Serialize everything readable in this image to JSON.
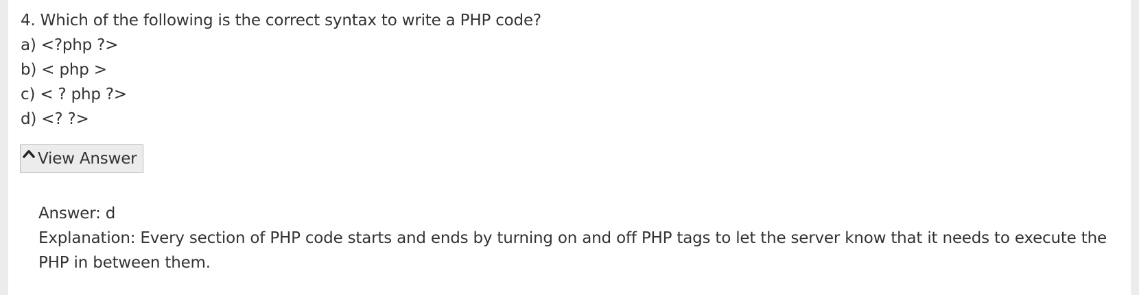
{
  "question": {
    "text": "4. Which of the following is the correct syntax to write a PHP code?",
    "options": [
      "a) <?php ?>",
      "b) < php >",
      "c) < ? php ?>",
      "d) <? ?>"
    ]
  },
  "view_answer": {
    "label": "View Answer",
    "icon": "caret-up-icon"
  },
  "answer": {
    "answer_text": "Answer: d",
    "explanation": "Explanation: Every section of PHP code starts and ends by turning on and off PHP tags to let the server know that it needs to execute the PHP in between them."
  }
}
